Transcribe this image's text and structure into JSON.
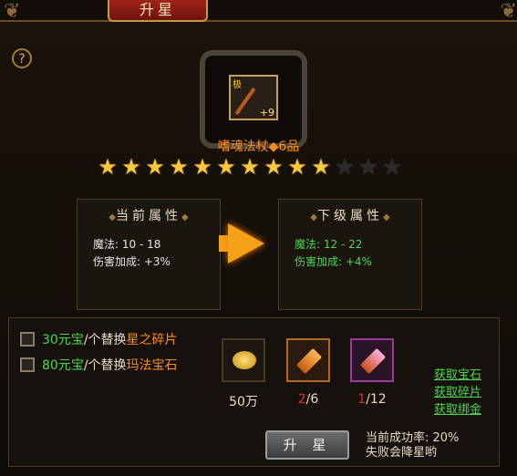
{
  "window": {
    "title": "升星"
  },
  "help": {
    "label": "?"
  },
  "item": {
    "grade_badge": "极",
    "enhance_level": "+9",
    "name": "嗜魂法杖◆6品",
    "stars_filled": 10,
    "stars_total": 13
  },
  "current_attrs": {
    "title": "当前属性",
    "rows": [
      {
        "label": "魔法: ",
        "value": "10 - 18"
      },
      {
        "label": "伤害加成: ",
        "value": "+3%"
      }
    ]
  },
  "next_attrs": {
    "title": "下级属性",
    "rows": [
      {
        "label": "魔法: ",
        "value": "12 - 22"
      },
      {
        "label": "伤害加成: ",
        "value": "+4%"
      }
    ]
  },
  "options": [
    {
      "price": "30元宝",
      "mid": "/个替换",
      "material": "星之碎片"
    },
    {
      "price": "80元宝",
      "mid": "/个替换",
      "material": "玛法宝石"
    }
  ],
  "materials": {
    "gold": {
      "amount": "50万",
      "icon": "gold-coins-icon"
    },
    "star_shard": {
      "have": "2",
      "need": "/6",
      "icon": "star-shard-icon"
    },
    "mafa_gem": {
      "have": "1",
      "need": "/12",
      "icon": "mafa-gem-icon"
    }
  },
  "links": [
    "获取宝石",
    "获取碎片",
    "获取绑金"
  ],
  "action": {
    "label": "升 星"
  },
  "status": {
    "success_rate": "当前成功率: 20%",
    "fail_note": "失败会降星哟"
  },
  "colors": {
    "highlight_green": "#4ed64e",
    "orange": "#ff8c1a",
    "red": "#e23030",
    "star_gold": "#f4c840"
  }
}
